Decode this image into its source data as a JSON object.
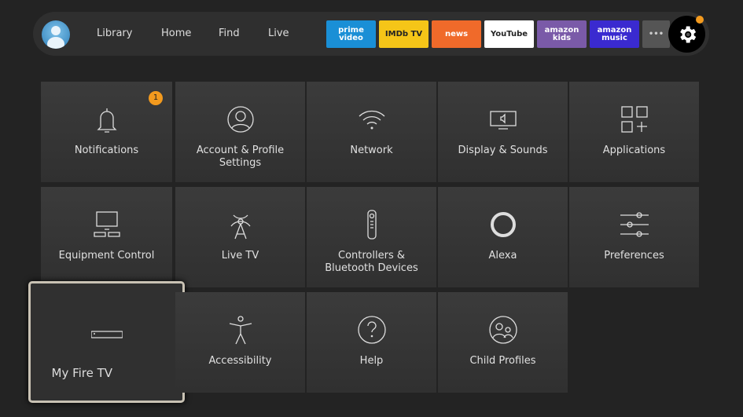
{
  "nav": {
    "items": [
      "Library",
      "Home",
      "Find",
      "Live"
    ]
  },
  "apps": [
    {
      "label": "prime video",
      "bg": "#1a8fd6",
      "color": "#fff"
    },
    {
      "label": "IMDb TV",
      "bg": "#f5c518",
      "color": "#222"
    },
    {
      "label": "news",
      "bg": "#f06a2a",
      "color": "#fff"
    },
    {
      "label": "YouTube",
      "bg": "#ffffff",
      "color": "#222"
    },
    {
      "label": "amazon kids",
      "bg": "#7a5aa8",
      "color": "#fff"
    },
    {
      "label": "amazon music",
      "bg": "#3a2ad0",
      "color": "#fff"
    },
    {
      "label": "•••",
      "bg": "#555555",
      "color": "#ccc"
    }
  ],
  "settings": {
    "notification_dot_color": "#f39a1e"
  },
  "tiles": [
    {
      "label": "Notifications",
      "icon": "bell-icon",
      "badge": "1"
    },
    {
      "label": "Account & Profile Settings",
      "icon": "user-icon"
    },
    {
      "label": "Network",
      "icon": "wifi-icon"
    },
    {
      "label": "Display & Sounds",
      "icon": "display-icon"
    },
    {
      "label": "Applications",
      "icon": "apps-icon"
    },
    {
      "label": "Equipment Control",
      "icon": "tv-icon"
    },
    {
      "label": "Live TV",
      "icon": "antenna-icon"
    },
    {
      "label": "Controllers & Bluetooth Devices",
      "icon": "remote-icon"
    },
    {
      "label": "Alexa",
      "icon": "alexa-icon"
    },
    {
      "label": "Preferences",
      "icon": "sliders-icon"
    },
    {
      "label": "My Fire TV",
      "icon": "fire-tv-device-icon"
    },
    {
      "label": "Accessibility",
      "icon": "accessibility-icon"
    },
    {
      "label": "Help",
      "icon": "help-icon"
    },
    {
      "label": "Child Profiles",
      "icon": "child-profiles-icon"
    }
  ]
}
